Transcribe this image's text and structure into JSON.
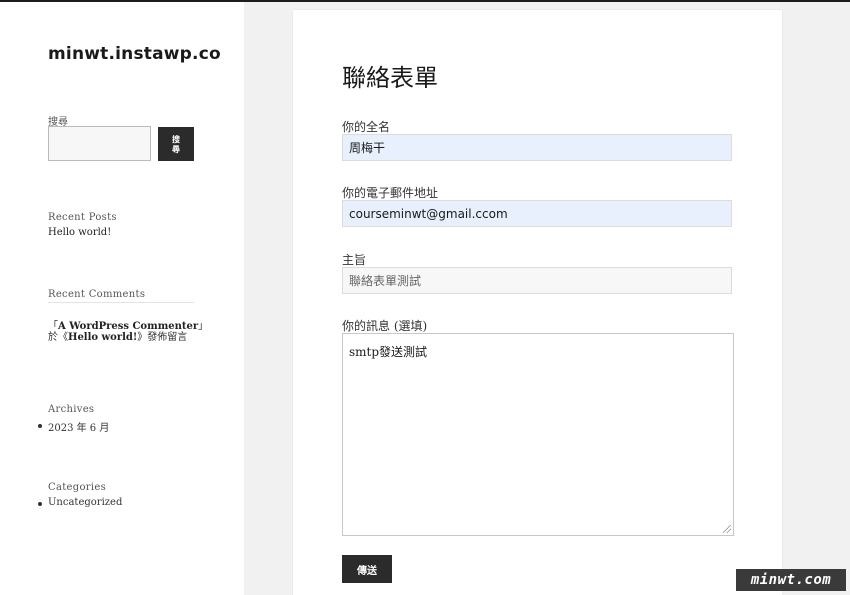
{
  "site": {
    "title": "minwt.instawp.co"
  },
  "search": {
    "label": "搜尋",
    "button_label": "搜尋",
    "value": ""
  },
  "widgets": {
    "recent_posts": {
      "title": "Recent Posts",
      "items": [
        "Hello world!"
      ]
    },
    "recent_comments": {
      "title": "Recent Comments",
      "comment": {
        "open_quote": "「",
        "author": "A WordPress Commenter",
        "close_quote": "」",
        "prefix": "於《",
        "post": "Hello world!",
        "suffix": "》發佈留言"
      }
    },
    "archives": {
      "title": "Archives",
      "items": [
        "2023 年 6 月"
      ]
    },
    "categories": {
      "title": "Categories",
      "items": [
        "Uncategorized"
      ]
    }
  },
  "form": {
    "title": "聯絡表單",
    "name_label": "你的全名",
    "name_value": "周梅干",
    "email_label": "你的電子郵件地址",
    "email_value": "courseminwt@gmail.ccom",
    "subject_label": "主旨",
    "subject_value": "聯絡表單測試",
    "message_label": "你的訊息 (選填)",
    "message_value": "smtp發送測試",
    "submit_label": "傳送"
  },
  "watermark": {
    "text": "minwt.com"
  },
  "colors": {
    "button_bg": "#2b2b2b",
    "autofill_bg": "#e8f0fe",
    "page_bg": "#f1f1f1"
  }
}
